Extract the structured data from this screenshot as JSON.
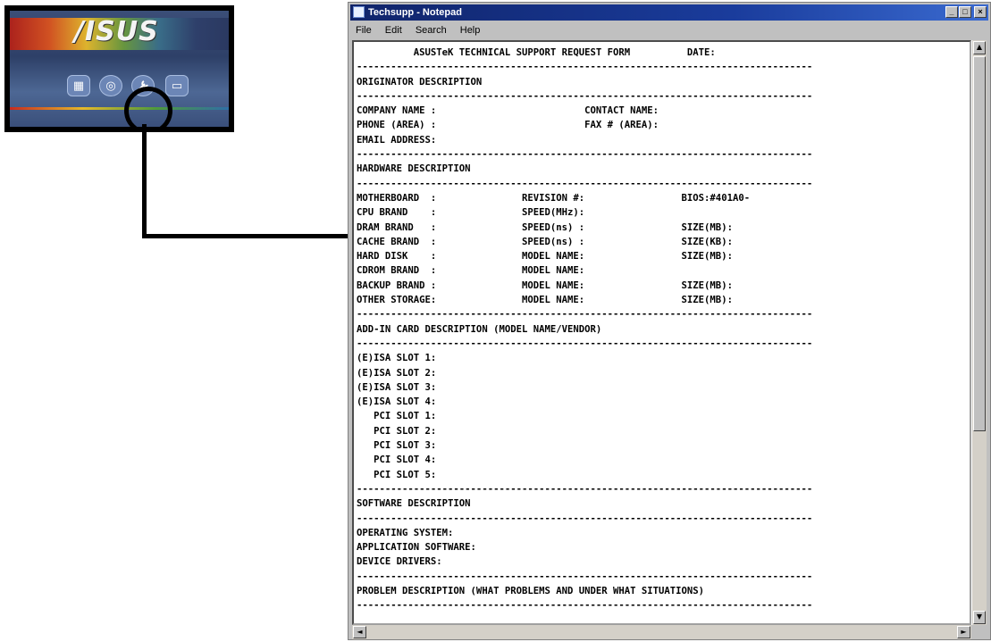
{
  "launcher": {
    "logo": "/ISUS",
    "icons": [
      "grid-icon",
      "cd-icon",
      "wrench-icon",
      "document-icon"
    ],
    "highlighted": "wrench-icon"
  },
  "window": {
    "title": "Techsupp - Notepad",
    "minimize": "_",
    "maximize": "□",
    "close": "×"
  },
  "menu": {
    "file": "File",
    "edit": "Edit",
    "search": "Search",
    "help": "Help"
  },
  "document": {
    "lines": [
      "          ASUSTeK TECHNICAL SUPPORT REQUEST FORM          DATE:",
      "--------------------------------------------------------------------------------",
      "ORIGINATOR DESCRIPTION",
      "--------------------------------------------------------------------------------",
      "COMPANY NAME :                          CONTACT NAME:",
      "PHONE (AREA) :                          FAX # (AREA):",
      "EMAIL ADDRESS:",
      "--------------------------------------------------------------------------------",
      "HARDWARE DESCRIPTION",
      "--------------------------------------------------------------------------------",
      "MOTHERBOARD  :               REVISION #:                 BIOS:#401A0-",
      "CPU BRAND    :               SPEED(MHz):",
      "DRAM BRAND   :               SPEED(ns) :                 SIZE(MB):",
      "CACHE BRAND  :               SPEED(ns) :                 SIZE(KB):",
      "HARD DISK    :               MODEL NAME:                 SIZE(MB):",
      "CDROM BRAND  :               MODEL NAME:",
      "BACKUP BRAND :               MODEL NAME:                 SIZE(MB):",
      "OTHER STORAGE:               MODEL NAME:                 SIZE(MB):",
      "--------------------------------------------------------------------------------",
      "ADD-IN CARD DESCRIPTION (MODEL NAME/VENDOR)",
      "--------------------------------------------------------------------------------",
      "(E)ISA SLOT 1:",
      "(E)ISA SLOT 2:",
      "(E)ISA SLOT 3:",
      "(E)ISA SLOT 4:",
      "   PCI SLOT 1:",
      "   PCI SLOT 2:",
      "   PCI SLOT 3:",
      "   PCI SLOT 4:",
      "   PCI SLOT 5:",
      "--------------------------------------------------------------------------------",
      "SOFTWARE DESCRIPTION",
      "--------------------------------------------------------------------------------",
      "OPERATING SYSTEM:",
      "APPLICATION SOFTWARE:",
      "DEVICE DRIVERS:",
      "--------------------------------------------------------------------------------",
      "PROBLEM DESCRIPTION (WHAT PROBLEMS AND UNDER WHAT SITUATIONS)",
      "--------------------------------------------------------------------------------"
    ]
  },
  "scrollbar": {
    "up": "▲",
    "down": "▼",
    "left": "◄",
    "right": "►"
  }
}
